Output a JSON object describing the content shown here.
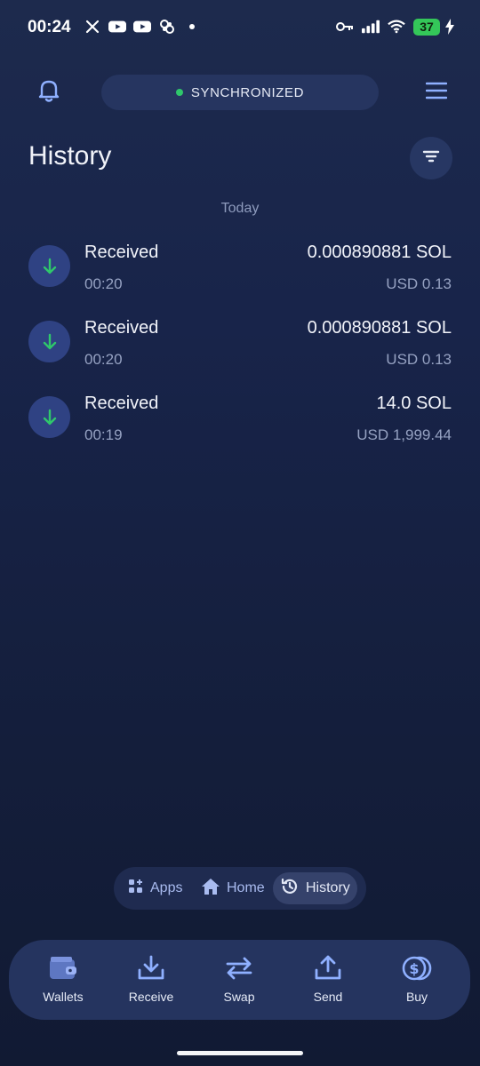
{
  "status_bar": {
    "time": "00:24",
    "battery": "37",
    "left_icons": [
      "x-icon",
      "youtube-icon",
      "youtube-icon",
      "app-icon",
      "dot-icon"
    ],
    "right_icons": [
      "key-icon",
      "signal-icon",
      "wifi-icon",
      "battery-icon",
      "charging-icon"
    ]
  },
  "top_bar": {
    "sync_status": "SYNCHRONIZED",
    "sync_color": "#2fc76b"
  },
  "header": {
    "title": "History"
  },
  "section_label": "Today",
  "transactions": [
    {
      "type": "Received",
      "time": "00:20",
      "amount": "0.000890881 SOL",
      "fiat": "USD 0.13"
    },
    {
      "type": "Received",
      "time": "00:20",
      "amount": "0.000890881 SOL",
      "fiat": "USD 0.13"
    },
    {
      "type": "Received",
      "time": "00:19",
      "amount": "14.0 SOL",
      "fiat": "USD 1,999.44"
    }
  ],
  "mini_tabs": [
    {
      "label": "Apps",
      "icon": "apps-icon"
    },
    {
      "label": "Home",
      "icon": "home-icon"
    },
    {
      "label": "History",
      "icon": "history-icon",
      "active": true
    }
  ],
  "bottom_nav": [
    {
      "label": "Wallets",
      "icon": "wallet-icon"
    },
    {
      "label": "Receive",
      "icon": "receive-icon"
    },
    {
      "label": "Swap",
      "icon": "swap-icon"
    },
    {
      "label": "Send",
      "icon": "send-icon"
    },
    {
      "label": "Buy",
      "icon": "buy-icon"
    }
  ],
  "colors": {
    "accent": "#8fb0ff",
    "received_arrow": "#2fc76b",
    "background": "#18244a"
  }
}
